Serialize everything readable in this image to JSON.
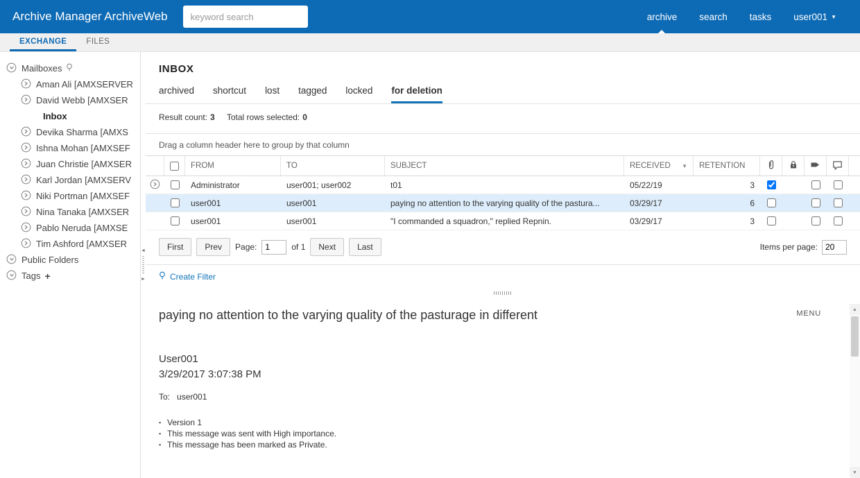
{
  "topbar": {
    "title": "Archive Manager ArchiveWeb",
    "search_placeholder": "keyword search",
    "nav": {
      "archive": "archive",
      "search": "search",
      "tasks": "tasks",
      "user": "user001"
    }
  },
  "module_tabs": {
    "exchange": "EXCHANGE",
    "files": "FILES"
  },
  "sidebar": {
    "mailboxes_label": "Mailboxes",
    "items": [
      {
        "label": "Aman Ali [AMXSERVER"
      },
      {
        "label": "David Webb [AMXSER"
      },
      {
        "label": "Inbox"
      },
      {
        "label": "Devika Sharma [AMXS"
      },
      {
        "label": "Ishna Mohan [AMXSEF"
      },
      {
        "label": "Juan Christie [AMXSER"
      },
      {
        "label": "Karl Jordan [AMXSERV"
      },
      {
        "label": "Niki Portman [AMXSEF"
      },
      {
        "label": "Nina Tanaka [AMXSER"
      },
      {
        "label": "Pablo Neruda [AMXSE"
      },
      {
        "label": "Tim Ashford [AMXSER"
      }
    ],
    "public_folders_label": "Public Folders",
    "tags_label": "Tags",
    "tags_add": "+"
  },
  "inbox": {
    "title": "INBOX",
    "view_tabs": [
      "archived",
      "shortcut",
      "lost",
      "tagged",
      "locked",
      "for deletion"
    ],
    "active_view": "for deletion",
    "result_count_label": "Result count:",
    "result_count": "3",
    "selected_label": "Total rows selected:",
    "selected_count": "0",
    "group_hint": "Drag a column header here to group by that column",
    "columns": {
      "from": "FROM",
      "to": "TO",
      "subject": "SUBJECT",
      "received": "RECEIVED",
      "retention": "RETENTION"
    },
    "rows": [
      {
        "from": "Administrator",
        "to": "user001; user002",
        "subject": "t01",
        "received": "05/22/19",
        "retention": "3"
      },
      {
        "from": "user001",
        "to": "user001",
        "subject": "paying no attention to the varying quality of the pastura...",
        "received": "03/29/17",
        "retention": "6"
      },
      {
        "from": "user001",
        "to": "user001",
        "subject": "\"I commanded a squadron,\" replied Repnin.",
        "received": "03/29/17",
        "retention": "3"
      }
    ],
    "pager": {
      "first": "First",
      "prev": "Prev",
      "page_label": "Page:",
      "page_value": "1",
      "of": "of 1",
      "next": "Next",
      "last": "Last",
      "items_per_page_label": "Items per page:",
      "items_per_page_value": "20"
    },
    "create_filter": "Create Filter"
  },
  "preview": {
    "subject": "paying no attention to the varying quality of the pasturage in different",
    "menu": "MENU",
    "sender": "User001",
    "datetime": "3/29/2017 3:07:38 PM",
    "to_label": "To:",
    "to_value": "user001",
    "bullets": [
      "Version  1",
      "This message was sent with High importance.",
      "This message has been marked as Private."
    ]
  }
}
